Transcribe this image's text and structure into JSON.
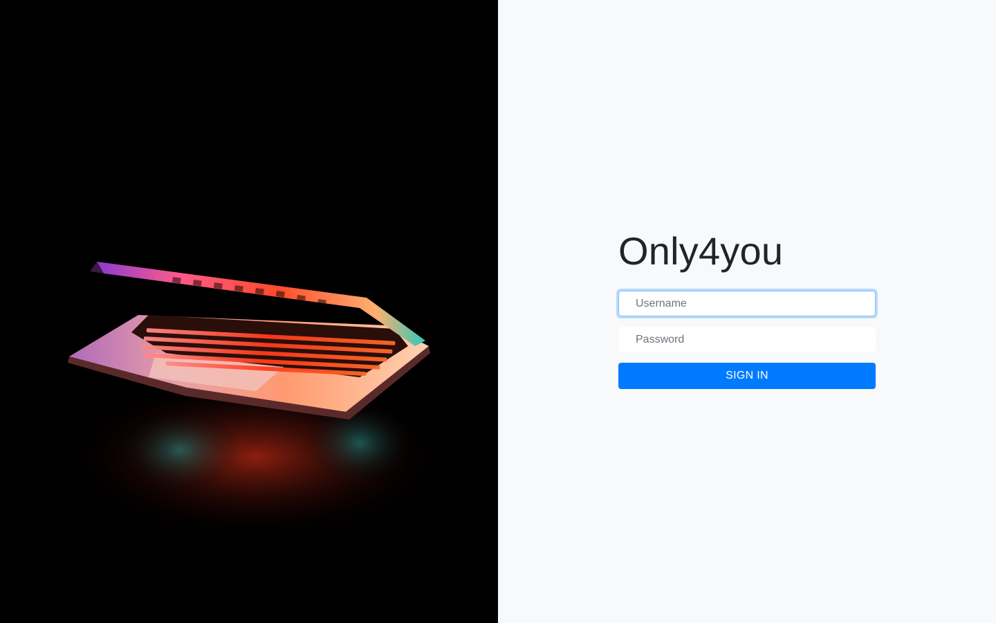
{
  "app": {
    "title": "Only4you"
  },
  "hero": {
    "image_subject": "laptop-glowing-keyboard",
    "colors": {
      "background": "#000000",
      "glow_red": "#ff3a1a",
      "glow_orange": "#ff8a4a",
      "glow_pink": "#e05aa0",
      "glow_teal": "#1fa6a0"
    }
  },
  "login": {
    "username": {
      "value": "",
      "placeholder": "Username"
    },
    "password": {
      "value": "",
      "placeholder": "Password"
    },
    "submit_label": "SIGN IN"
  },
  "theme": {
    "accent": "#007bff",
    "panel_background": "#f8f9fa",
    "focus_ring": "#80bdff"
  }
}
